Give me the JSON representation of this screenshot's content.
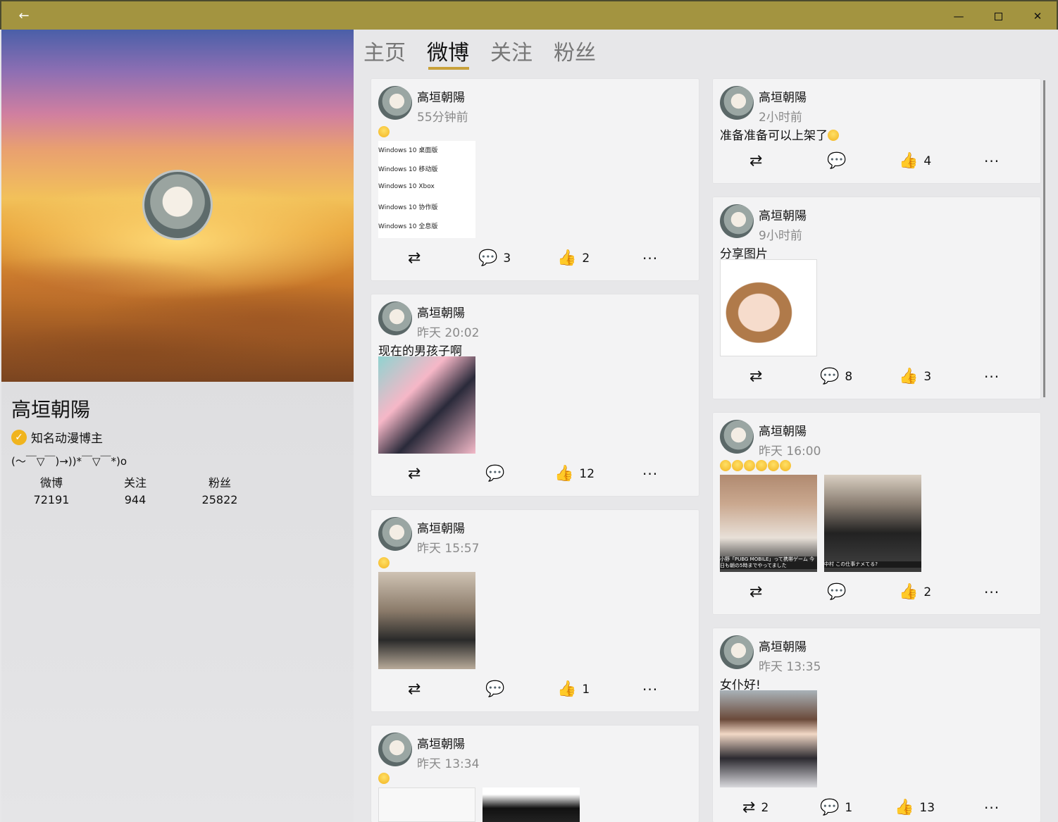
{
  "window": {
    "back": "←",
    "minimize": "—",
    "close": "✕"
  },
  "profile": {
    "name": "高垣朝陽",
    "verified_label": "知名动漫博主",
    "bio": "(～￣▽￣)→))*￣▽￣*)o",
    "stats": [
      {
        "label": "微博",
        "value": "72191"
      },
      {
        "label": "关注",
        "value": "944"
      },
      {
        "label": "粉丝",
        "value": "25822"
      }
    ]
  },
  "tabs": [
    {
      "label": "主页"
    },
    {
      "label": "微博"
    },
    {
      "label": "关注"
    },
    {
      "label": "粉丝"
    }
  ],
  "active_tab": "微博",
  "icons": {
    "repost": "repost-icon",
    "comment": "comment-icon",
    "like": "like-icon",
    "more": "more-icon"
  },
  "posts": [
    {
      "author": "高垣朝陽",
      "time": "55分钟前",
      "text": "",
      "emoji_count": 1,
      "image_text": [
        "Windows 10 桌面版",
        "Windows 10 移动版",
        "Windows 10 Xbox",
        "Windows 10 协作版",
        "Windows 10 全息版"
      ],
      "repost": "",
      "comments": "3",
      "likes": "2",
      "more": "···"
    },
    {
      "author": "高垣朝陽",
      "time": "昨天 20:02",
      "text": "现在的男孩子啊",
      "repost": "",
      "comments": "",
      "likes": "12",
      "more": "···"
    },
    {
      "author": "高垣朝陽",
      "time": "昨天 15:57",
      "text": "",
      "emoji_count": 1,
      "repost": "",
      "comments": "",
      "likes": "1",
      "more": "···"
    },
    {
      "author": "高垣朝陽",
      "time": "昨天 13:34",
      "text": "",
      "emoji_count": 1
    },
    {
      "author": "高垣朝陽",
      "time": "2小时前",
      "text": "准备准备可以上架了",
      "repost": "",
      "comments": "",
      "likes": "4",
      "more": "···"
    },
    {
      "author": "高垣朝陽",
      "time": "9小时前",
      "text": "分享图片",
      "repost": "",
      "comments": "8",
      "likes": "3",
      "more": "···"
    },
    {
      "author": "高垣朝陽",
      "time": "昨天 16:00",
      "text": "",
      "emoji_count": 6,
      "image_captions": [
        "小野「PUBG MOBILE」って携帯ゲーム 今日も朝の5時までやってました",
        "中村 この仕事ナメてる?"
      ],
      "repost": "",
      "comments": "",
      "likes": "2",
      "more": "···"
    },
    {
      "author": "高垣朝陽",
      "time": "昨天 13:35",
      "text": "女仆好!",
      "repost": "2",
      "comments": "1",
      "likes": "13",
      "more": "···"
    }
  ]
}
